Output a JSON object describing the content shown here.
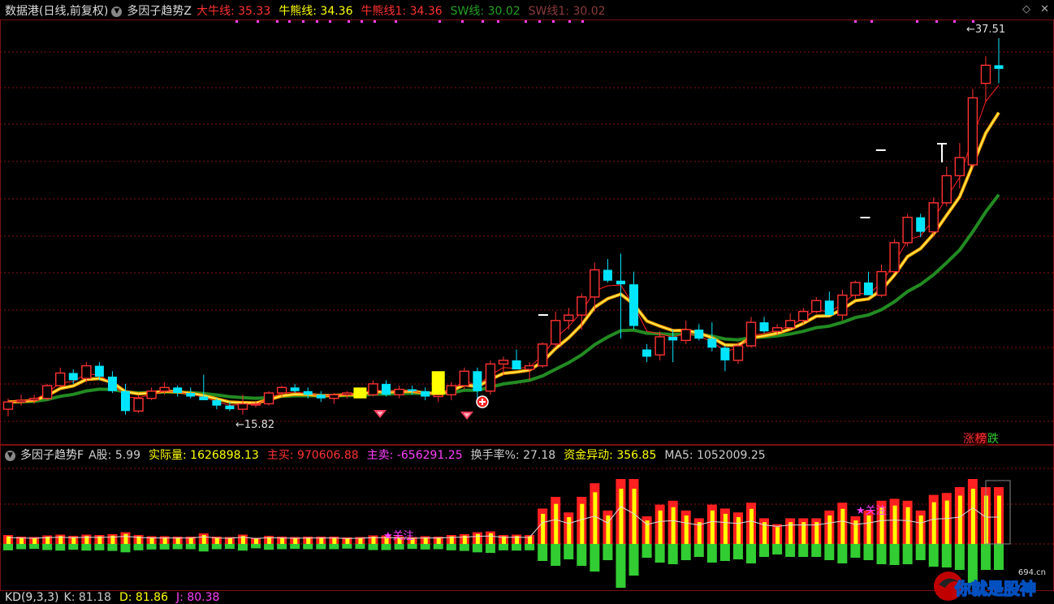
{
  "main_header": {
    "title": "数据港",
    "period": "(日线,前复权)",
    "indicator": "多因子趋势Z",
    "items": [
      {
        "label": "大牛线: ",
        "value": "35.33",
        "color": "#ff3232"
      },
      {
        "label": "牛熊线: ",
        "value": "34.36",
        "color": "#ffff00"
      },
      {
        "label": "牛熊线1: ",
        "value": "34.36",
        "color": "#ff3232"
      },
      {
        "label": "SW线: ",
        "value": "30.02",
        "color": "#22a022"
      },
      {
        "label": "SW线1: ",
        "value": "30.02",
        "color": "#8b3a3a"
      }
    ]
  },
  "sub_header": {
    "indicator": "多因子趋势F",
    "items": [
      {
        "label": "A股: ",
        "value": "5.99",
        "color": "#cccccc"
      },
      {
        "label": "实际量: ",
        "value": "1626898.13",
        "color": "#ffff00"
      },
      {
        "label": "主买: ",
        "value": "970606.88",
        "color": "#ff3232"
      },
      {
        "label": "主卖: ",
        "value": "-656291.25",
        "color": "#ff40ff"
      },
      {
        "label": "换手率%: ",
        "value": "27.18",
        "color": "#cccccc"
      },
      {
        "label": "资金异动: ",
        "value": "356.85",
        "color": "#ffff00"
      },
      {
        "label": "MA5: ",
        "value": "1052009.25",
        "color": "#cccccc"
      }
    ]
  },
  "kd_header": {
    "label": "KD(9,3,3)",
    "items": [
      {
        "label": "K: ",
        "value": "81.18",
        "color": "#cccccc"
      },
      {
        "label": "D: ",
        "value": "81.86",
        "color": "#ffff00"
      },
      {
        "label": "J: ",
        "value": "80.38",
        "color": "#ff40ff"
      }
    ]
  },
  "annotations": {
    "high_label": "37.51",
    "low_label": "15.82",
    "focus_label_1": "关注",
    "focus_label_2": "关注"
  },
  "rank_badge": {
    "zhang": "涨",
    "bang": "榜",
    "die": "跌"
  },
  "watermark": {
    "text": "你就是股神",
    "site": "694.cn"
  },
  "colors": {
    "up": "#ff3232",
    "down": "#00e5ff",
    "grid": "#8b1010"
  },
  "chart_data": {
    "type": "candlestick",
    "price_range": [
      14,
      39
    ],
    "candles": [
      [
        17.0,
        17.6,
        16.6,
        17.4
      ],
      [
        17.4,
        17.8,
        17.2,
        17.5
      ],
      [
        17.5,
        17.8,
        17.3,
        17.6
      ],
      [
        17.6,
        18.4,
        17.5,
        18.3
      ],
      [
        18.3,
        19.3,
        18.2,
        19.0
      ],
      [
        19.0,
        19.2,
        18.4,
        18.6
      ],
      [
        18.7,
        19.6,
        18.5,
        19.4
      ],
      [
        19.4,
        19.6,
        18.6,
        18.8
      ],
      [
        18.8,
        19.1,
        17.9,
        18.0
      ],
      [
        18.0,
        18.4,
        16.7,
        16.9
      ],
      [
        16.9,
        17.8,
        16.8,
        17.6
      ],
      [
        17.6,
        18.2,
        17.5,
        18.0
      ],
      [
        18.0,
        18.5,
        17.8,
        18.2
      ],
      [
        18.2,
        18.3,
        17.7,
        17.9
      ],
      [
        17.9,
        18.2,
        17.6,
        17.7
      ],
      [
        17.7,
        18.9,
        17.5,
        17.5
      ],
      [
        17.5,
        17.6,
        17.0,
        17.2
      ],
      [
        17.2,
        17.4,
        16.9,
        17.0
      ],
      [
        17.0,
        17.8,
        16.7,
        17.3
      ],
      [
        17.3,
        17.4,
        17.1,
        17.3
      ],
      [
        17.3,
        18.0,
        17.2,
        17.9
      ],
      [
        17.9,
        18.3,
        17.7,
        18.2
      ],
      [
        18.2,
        18.4,
        17.9,
        18.0
      ],
      [
        18.0,
        18.2,
        17.6,
        17.8
      ],
      [
        17.8,
        18.0,
        17.4,
        17.6
      ],
      [
        17.6,
        17.9,
        17.3,
        17.8
      ],
      [
        17.8,
        18.0,
        17.6,
        17.9
      ],
      [
        17.9,
        18.1,
        17.6,
        17.8
      ],
      [
        17.8,
        18.6,
        17.7,
        18.4
      ],
      [
        18.4,
        18.6,
        17.7,
        17.8
      ],
      [
        17.8,
        18.3,
        17.6,
        18.1
      ],
      [
        18.1,
        18.3,
        17.8,
        18.0
      ],
      [
        18.0,
        18.2,
        17.5,
        17.7
      ],
      [
        17.7,
        18.0,
        17.4,
        17.8
      ],
      [
        17.8,
        18.5,
        17.5,
        18.3
      ],
      [
        18.3,
        19.3,
        18.1,
        19.1
      ],
      [
        19.1,
        19.3,
        17.6,
        18.0
      ],
      [
        18.0,
        19.7,
        17.8,
        19.5
      ],
      [
        19.5,
        19.9,
        18.9,
        19.7
      ],
      [
        19.7,
        20.3,
        19.2,
        19.2
      ],
      [
        19.2,
        19.6,
        18.6,
        19.4
      ],
      [
        19.4,
        20.7,
        19.3,
        20.6
      ],
      [
        20.6,
        22.4,
        20.4,
        21.9
      ],
      [
        21.9,
        22.6,
        21.4,
        22.2
      ],
      [
        22.2,
        23.4,
        21.4,
        23.2
      ],
      [
        23.2,
        25.1,
        22.4,
        24.7
      ],
      [
        24.7,
        25.3,
        24.0,
        24.1
      ],
      [
        24.1,
        25.6,
        20.9,
        23.9
      ],
      [
        23.9,
        24.6,
        21.4,
        21.6
      ],
      [
        20.3,
        20.6,
        19.6,
        19.9
      ],
      [
        20.0,
        21.3,
        19.7,
        21.0
      ],
      [
        21.0,
        21.4,
        19.6,
        20.8
      ],
      [
        20.8,
        21.9,
        20.6,
        21.4
      ],
      [
        21.4,
        21.7,
        20.8,
        20.9
      ],
      [
        20.9,
        21.8,
        20.2,
        20.4
      ],
      [
        20.4,
        20.5,
        19.1,
        19.7
      ],
      [
        19.7,
        20.7,
        19.5,
        20.5
      ],
      [
        20.5,
        22.1,
        20.4,
        21.8
      ],
      [
        21.8,
        22.1,
        21.2,
        21.3
      ],
      [
        21.3,
        21.7,
        21.1,
        21.5
      ],
      [
        21.5,
        22.3,
        21.4,
        21.9
      ],
      [
        21.9,
        22.6,
        21.7,
        22.4
      ],
      [
        22.4,
        23.2,
        22.3,
        23.0
      ],
      [
        23.0,
        23.5,
        22.2,
        22.2
      ],
      [
        22.2,
        23.6,
        21.9,
        23.3
      ],
      [
        23.3,
        24.1,
        23.1,
        24.0
      ],
      [
        24.0,
        24.6,
        23.3,
        23.3
      ],
      [
        23.3,
        25.0,
        23.2,
        24.6
      ],
      [
        24.6,
        26.4,
        24.5,
        26.2
      ],
      [
        26.2,
        27.8,
        26.0,
        27.6
      ],
      [
        27.6,
        27.8,
        26.5,
        26.8
      ],
      [
        26.8,
        28.7,
        26.6,
        28.4
      ],
      [
        28.4,
        30.4,
        28.2,
        29.9
      ],
      [
        29.9,
        31.7,
        29.2,
        30.9
      ],
      [
        30.5,
        34.7,
        30.3,
        34.2
      ],
      [
        35.0,
        36.5,
        34.0,
        36.0
      ],
      [
        36.0,
        37.5,
        35.0,
        35.8
      ]
    ]
  }
}
